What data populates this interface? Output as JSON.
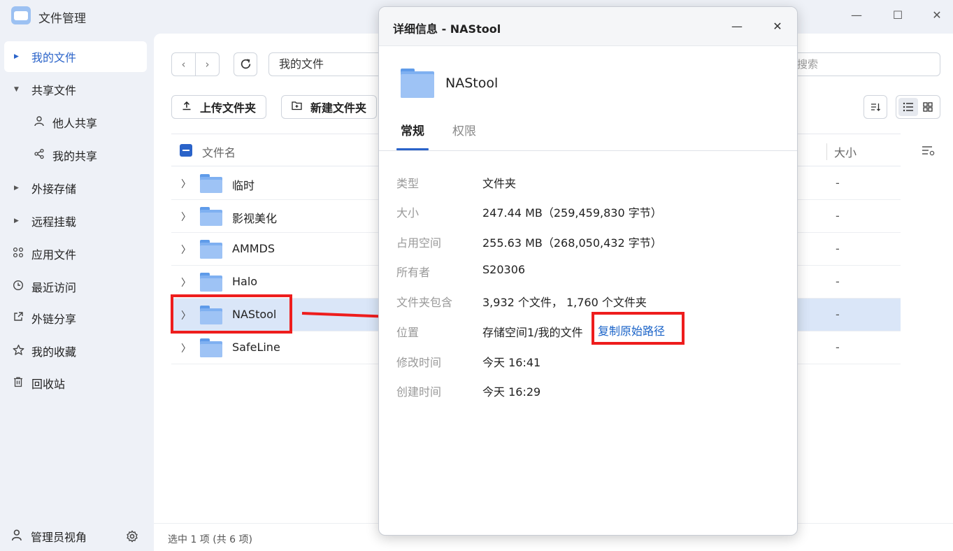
{
  "app": {
    "title": "文件管理",
    "window_controls": {
      "minimize": "—",
      "maximize": "☐",
      "close": "✕"
    }
  },
  "sidebar": {
    "items": [
      {
        "label": "我的文件",
        "icon": "caret-right-icon",
        "active": true
      },
      {
        "label": "共享文件",
        "icon": "caret-down-icon"
      },
      {
        "label": "他人共享",
        "icon": "person-icon",
        "sub": true
      },
      {
        "label": "我的共享",
        "icon": "share-icon",
        "sub": true
      },
      {
        "label": "外接存储",
        "icon": "caret-right-icon"
      },
      {
        "label": "远程挂载",
        "icon": "caret-right-icon"
      },
      {
        "label": "应用文件",
        "icon": "apps-icon"
      },
      {
        "label": "最近访问",
        "icon": "clock-icon"
      },
      {
        "label": "外链分享",
        "icon": "external-link-icon"
      },
      {
        "label": "我的收藏",
        "icon": "star-icon"
      },
      {
        "label": "回收站",
        "icon": "trash-icon"
      }
    ],
    "footer": {
      "label": "管理员视角",
      "icon": "admin-icon",
      "settings_icon": "gear-icon"
    }
  },
  "toolbar": {
    "back": "‹",
    "forward": "›",
    "path": "我的文件",
    "search_placeholder": "搜索",
    "upload_label": "上传文件夹",
    "new_folder_label": "新建文件夹"
  },
  "table": {
    "columns": {
      "name": "文件名",
      "size": "大小"
    },
    "rows": [
      {
        "name": "临时",
        "size": "-"
      },
      {
        "name": "影视美化",
        "size": "-"
      },
      {
        "name": "AMMDS",
        "size": "-"
      },
      {
        "name": "Halo",
        "size": "-"
      },
      {
        "name": "NAStool",
        "size": "-",
        "selected": true
      },
      {
        "name": "SafeLine",
        "size": "-"
      }
    ]
  },
  "status": {
    "text": "选中 1 项 (共 6 项)"
  },
  "dialog": {
    "title": "详细信息 - NAStool",
    "folder_name": "NAStool",
    "tabs": [
      "常规",
      "权限"
    ],
    "properties": [
      {
        "label": "类型",
        "value": "文件夹"
      },
      {
        "label": "大小",
        "value": "247.44 MB（259,459,830 字节）"
      },
      {
        "label": "占用空间",
        "value": "255.63 MB（268,050,432 字节）"
      },
      {
        "label": "所有者",
        "value": "S20306"
      },
      {
        "label": "文件夹包含",
        "value": "3,932 个文件， 1,760 个文件夹"
      },
      {
        "label": "位置",
        "value": "存储空间1/我的文件"
      },
      {
        "label": "修改时间",
        "value": "今天 16:41"
      },
      {
        "label": "创建时间",
        "value": "今天 16:29"
      }
    ],
    "copy_path_label": "复制原始路径"
  },
  "colors": {
    "accent": "#2a63c9",
    "annotation_red": "#ee1d1d",
    "selected_row": "#dae6f8"
  }
}
